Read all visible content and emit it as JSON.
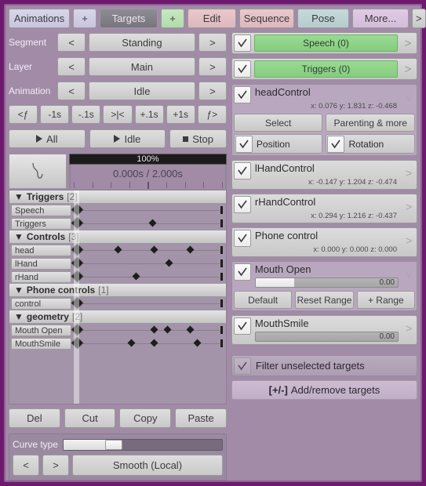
{
  "tabs": [
    {
      "key": "animations",
      "label": "Animations"
    },
    {
      "key": "plus1",
      "label": "+"
    },
    {
      "key": "targets",
      "label": "Targets"
    },
    {
      "key": "plus2",
      "label": "+"
    },
    {
      "key": "edit",
      "label": "Edit"
    },
    {
      "key": "sequence",
      "label": "Sequence"
    },
    {
      "key": "pose",
      "label": "Pose"
    },
    {
      "key": "more",
      "label": "More..."
    },
    {
      "key": "next",
      "label": ">"
    }
  ],
  "selectors": [
    {
      "label": "Segment",
      "prev": "<",
      "value": "Standing",
      "next": ">"
    },
    {
      "label": "Layer",
      "prev": "<",
      "value": "Main",
      "next": ">"
    },
    {
      "label": "Animation",
      "prev": "<",
      "value": "Idle",
      "next": ">"
    }
  ],
  "steps": [
    "<ƒ",
    "-1s",
    "-.1s",
    ">|<",
    "+.1s",
    "+1s",
    "ƒ>"
  ],
  "transport": {
    "all": "All",
    "idle": "Idle",
    "stop": "Stop"
  },
  "timeline": {
    "zoom": "100%",
    "time": "0.000s / 2.000s",
    "curve_icon": "curve-glyph"
  },
  "groups": [
    {
      "name": "Triggers",
      "count": "[2]",
      "tracks": [
        {
          "name": "Speech",
          "keys": [
            0,
            100
          ]
        },
        {
          "name": "Triggers",
          "keys": [
            0,
            52,
            100
          ]
        }
      ]
    },
    {
      "name": "Controls",
      "count": "[3]",
      "tracks": [
        {
          "name": "head",
          "keys": [
            0,
            29,
            53,
            77,
            100
          ]
        },
        {
          "name": "lHand",
          "keys": [
            0,
            63,
            100
          ]
        },
        {
          "name": "rHand",
          "keys": [
            0,
            41,
            100
          ]
        }
      ]
    },
    {
      "name": "Phone controls",
      "count": "[1]",
      "tracks": [
        {
          "name": "control",
          "keys": [
            0,
            100
          ]
        }
      ]
    },
    {
      "name": "geometry",
      "count": "[2]",
      "tracks": [
        {
          "name": "Mouth Open",
          "keys": [
            0,
            53,
            62,
            77,
            100
          ]
        },
        {
          "name": "MouthSmile",
          "keys": [
            0,
            38,
            53,
            82,
            100
          ]
        }
      ]
    }
  ],
  "edit_buttons": [
    "Del",
    "Cut",
    "Copy",
    "Paste"
  ],
  "curve": {
    "label": "Curve type",
    "prev": "<",
    "next": ">",
    "value": "Smooth (Local)"
  },
  "layers": [
    {
      "name": "Speech (0)",
      "chev": ">"
    },
    {
      "name": "Triggers (0)",
      "chev": ">"
    }
  ],
  "targets": [
    {
      "name": "headControl",
      "coords": "x: 0.076 y: 1.831 z: -0.468",
      "chev": "∨",
      "expanded": true,
      "buttons": [
        "Select",
        "Parenting & more"
      ],
      "toggles": [
        "Position",
        "Rotation"
      ]
    },
    {
      "name": "lHandControl",
      "coords": "x: -0.147 y: 1.204 z: -0.474",
      "chev": ">",
      "expanded": false
    },
    {
      "name": "rHandControl",
      "coords": "x: 0.294 y: 1.216 z: -0.437",
      "chev": ">",
      "expanded": false
    },
    {
      "name": "Phone control",
      "coords": "x: 0.000 y: 0.000 z: 0.000",
      "chev": ">",
      "expanded": false
    }
  ],
  "morphs": [
    {
      "name": "Mouth Open",
      "value": "0.00",
      "chev": "∨",
      "expanded": true,
      "buttons": [
        "Default",
        "Reset Range",
        "+ Range"
      ]
    },
    {
      "name": "MouthSmile",
      "value": "0.00",
      "chev": ">",
      "expanded": false
    }
  ],
  "footer": {
    "filter_label": "Filter unselected targets",
    "add_prefix": "[+/-]",
    "add_label": "Add/remove targets"
  },
  "colors": {
    "window_border": "#6d1a6e",
    "panel": "#a18ba7",
    "green": "#86cd80",
    "pink": "#ddb8bc",
    "teal": "#b5cccd",
    "lilac": "#d3bcd9"
  }
}
